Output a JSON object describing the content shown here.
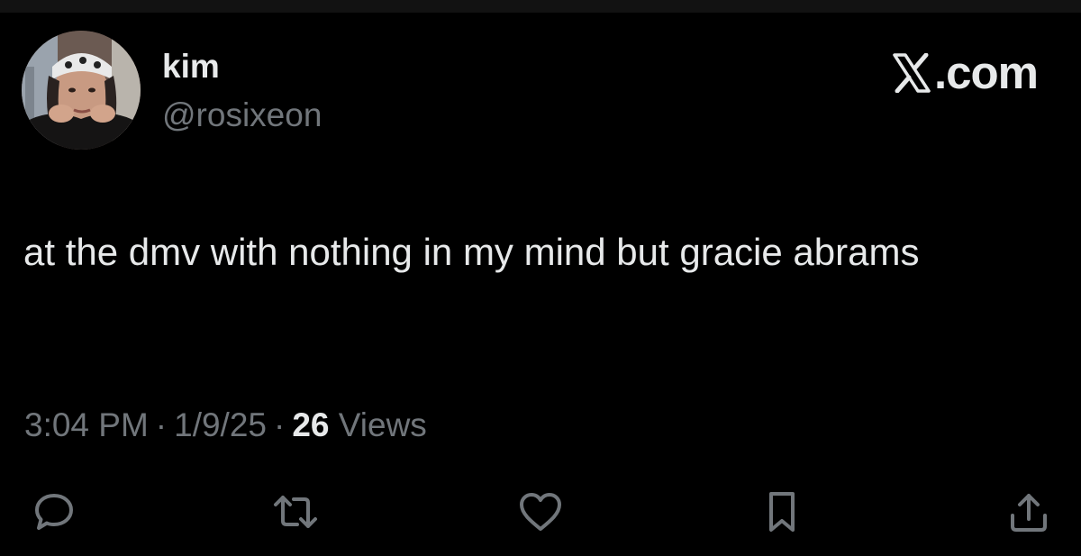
{
  "author": {
    "display_name": "kim",
    "handle": "@rosixeon"
  },
  "brand": {
    "text": ".com",
    "icon": "x-logo-icon"
  },
  "tweet": {
    "text": "at the dmv with nothing in my mind but gracie abrams"
  },
  "meta": {
    "time": "3:04 PM",
    "separator": "·",
    "date": "1/9/25",
    "views_count": "26",
    "views_label": "Views"
  },
  "actions": [
    {
      "name": "reply",
      "icon": "reply-icon"
    },
    {
      "name": "repost",
      "icon": "repost-icon"
    },
    {
      "name": "like",
      "icon": "heart-icon"
    },
    {
      "name": "bookmark",
      "icon": "bookmark-icon"
    },
    {
      "name": "share",
      "icon": "share-icon"
    }
  ],
  "colors": {
    "background": "#000000",
    "primary_text": "#e7e9ea",
    "secondary_text": "#71767b",
    "icon": "#71767b"
  }
}
